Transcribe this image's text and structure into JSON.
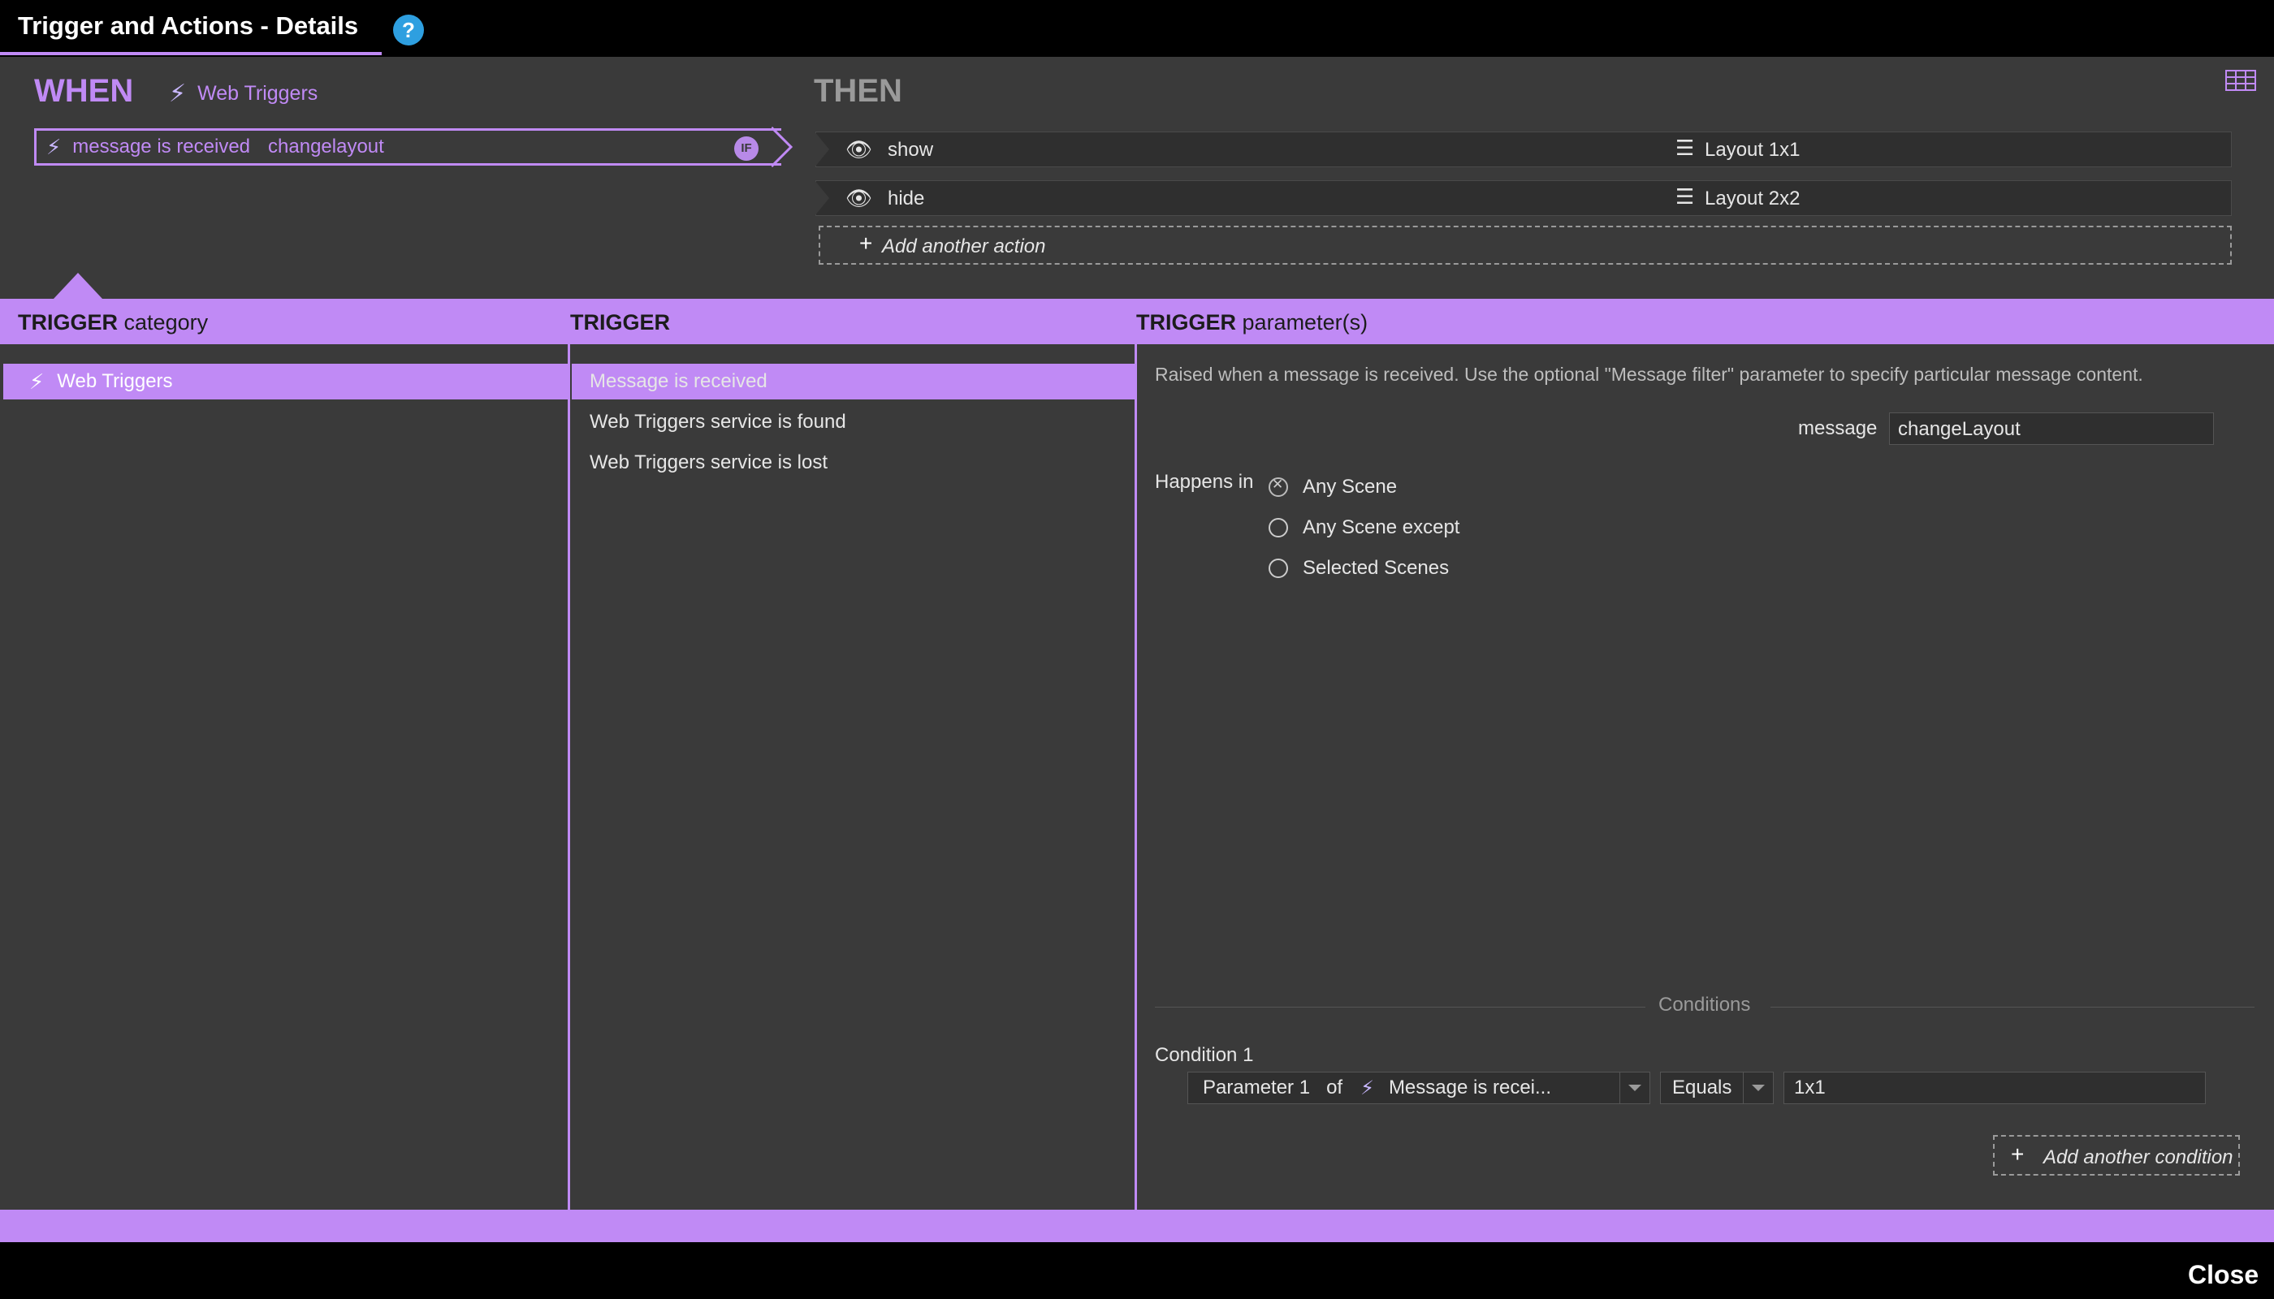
{
  "window": {
    "title": "Trigger and Actions - Details",
    "help_icon": "?"
  },
  "when": {
    "label": "WHEN",
    "category_icon": "web-triggers-icon",
    "category": "Web Triggers",
    "trigger_text": "message is received",
    "trigger_param": "changelayout",
    "if_badge": "IF"
  },
  "then": {
    "label": "THEN",
    "actions": [
      {
        "icon": "eye-icon",
        "verb": "show",
        "target_icon": "layer-icon",
        "target": "Layout 1x1"
      },
      {
        "icon": "eye-icon",
        "verb": "hide",
        "target_icon": "layer-icon",
        "target": "Layout 2x2"
      }
    ],
    "add_action": "Add another action"
  },
  "panels": {
    "category_header_bold": "TRIGGER",
    "category_header_rest": "category",
    "trigger_header_bold": "TRIGGER",
    "params_header_bold": "TRIGGER",
    "params_header_rest": "parameter(s)"
  },
  "categories": [
    {
      "label": "Web Triggers",
      "selected": true
    }
  ],
  "triggers": [
    {
      "label": "Message is received",
      "selected": true
    },
    {
      "label": "Web Triggers service is found",
      "selected": false
    },
    {
      "label": "Web Triggers service is lost",
      "selected": false
    }
  ],
  "params": {
    "description": "Raised when a message is received. Use the optional \"Message filter\" parameter to specify particular message content.",
    "message_label": "message",
    "message_value": "changeLayout",
    "happens_in_label": "Happens in",
    "scene_options": [
      {
        "label": "Any Scene",
        "selected": true
      },
      {
        "label": "Any Scene except",
        "selected": false
      },
      {
        "label": "Selected Scenes",
        "selected": false
      }
    ]
  },
  "conditions": {
    "title": "Conditions",
    "items": [
      {
        "label": "Condition 1",
        "param": "Parameter 1",
        "of": "of",
        "source": "Message is recei...",
        "operator": "Equals",
        "value": "1x1"
      }
    ],
    "add_condition": "Add another condition"
  },
  "footer": {
    "close": "Close"
  },
  "colors": {
    "accent": "#c08af5",
    "background": "#3a3a3a",
    "titlebar": "#000000",
    "help": "#2e9fe0"
  }
}
